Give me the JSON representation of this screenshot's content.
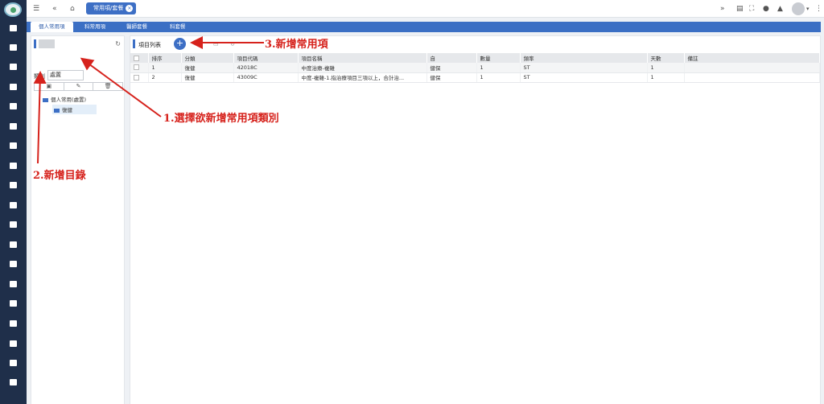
{
  "topbar": {
    "menu_icon": "hamburger-icon",
    "collapse_icon": "double-chevron-left-icon",
    "home_icon": "home-icon",
    "active_tab_label": "常用項/套餐",
    "right_icons": [
      "expand-icon",
      "document-icon",
      "fullscreen-icon",
      "chat-icon",
      "bell-icon",
      "avatar",
      "kebab-icon"
    ]
  },
  "main_tabs": [
    "個人常用項",
    "科常用項",
    "醫師套餐",
    "科套餐"
  ],
  "left_panel": {
    "category_label": "類別",
    "category_value": "處置",
    "buttons": [
      "folder-add-icon",
      "edit-icon",
      "trash-icon"
    ],
    "tree": {
      "root": "個人常用(處置)",
      "child": "復健"
    }
  },
  "right_panel": {
    "title": "項目列表",
    "add_button": "+",
    "columns": [
      "排序",
      "分類",
      "項目代碼",
      "項目名稱",
      "自",
      "數量",
      "頻率",
      "天數",
      "備註"
    ],
    "rows": [
      [
        "1",
        "復健",
        "42018C",
        "中度治療-複雜",
        "健保",
        "1",
        "ST",
        "1",
        ""
      ],
      [
        "2",
        "復健",
        "43009C",
        "中度-複雜-1.指治療項目三項以上，合計治...",
        "健保",
        "1",
        "ST",
        "1",
        ""
      ]
    ]
  },
  "annotations": {
    "step1": "1.選擇欲新增常用項類別",
    "step2": "2.新增目錄",
    "step3": "3.新增常用項",
    "color": "#d6221c"
  },
  "colors": {
    "rail": "#1f2f4a",
    "accent": "#3d6fc5",
    "tabs": "#3b6fc4"
  }
}
